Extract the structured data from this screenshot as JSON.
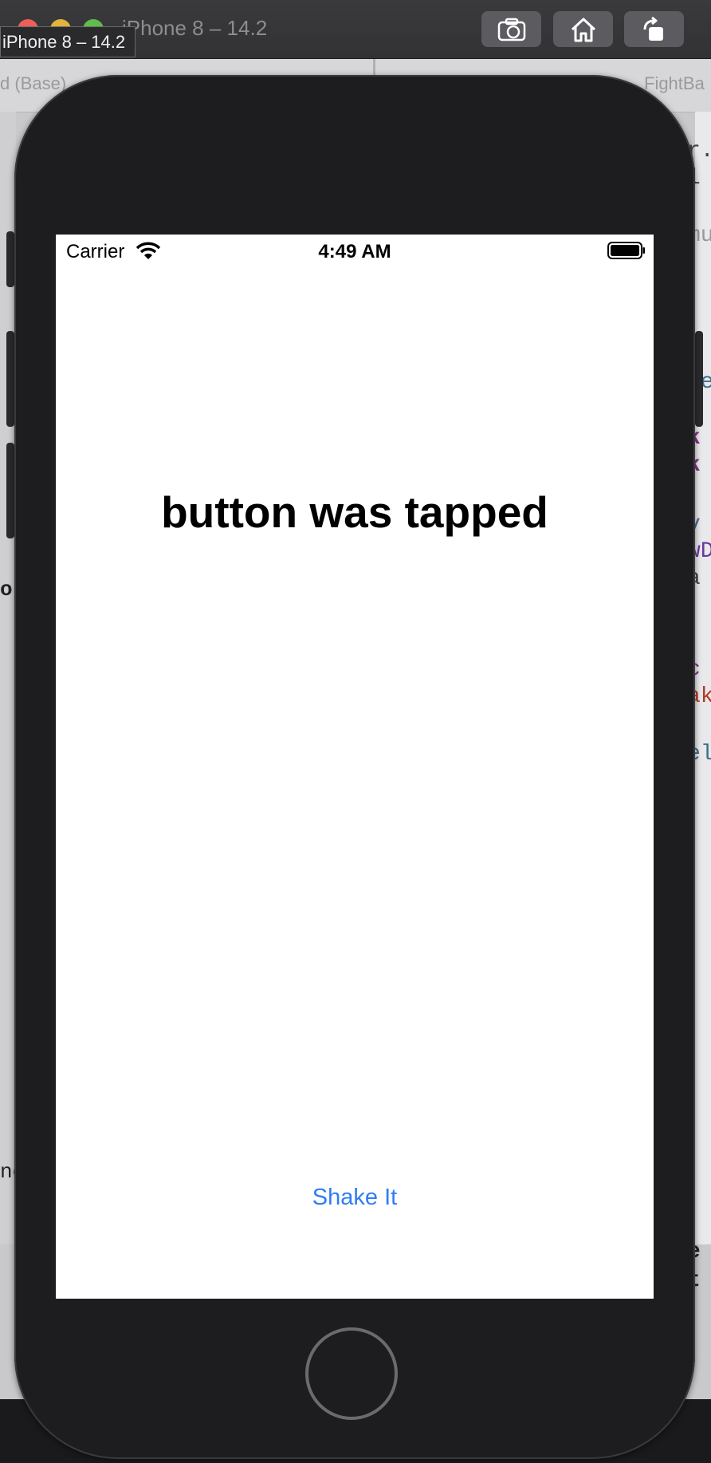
{
  "window": {
    "title": "iPhone 8 – 14.2",
    "tooltip": "iPhone 8 – 14.2"
  },
  "toolbar": {
    "screenshot_icon": "camera-icon",
    "home_icon": "home-icon",
    "rotate_icon": "rotate-icon"
  },
  "backdrop": {
    "left_tab": "d (Base)",
    "right_tab": "FightBa",
    "left_fragments": [
      "o",
      "no"
    ],
    "code_fragments": [
      "r.",
      "l",
      "mu",
      "le",
      "k",
      "k",
      "v",
      "wD",
      "a",
      "c",
      "ak",
      "el",
      "e",
      "t"
    ]
  },
  "status_bar": {
    "carrier": "Carrier",
    "time": "4:49 AM",
    "wifi_icon": "wifi-icon",
    "battery_icon": "battery-icon"
  },
  "screen": {
    "message": "button was tapped",
    "button_label": "Shake It"
  },
  "colors": {
    "accent": "#2f7cf6",
    "screen_background": "#ffffff",
    "device_body": "#1d1d1f"
  }
}
